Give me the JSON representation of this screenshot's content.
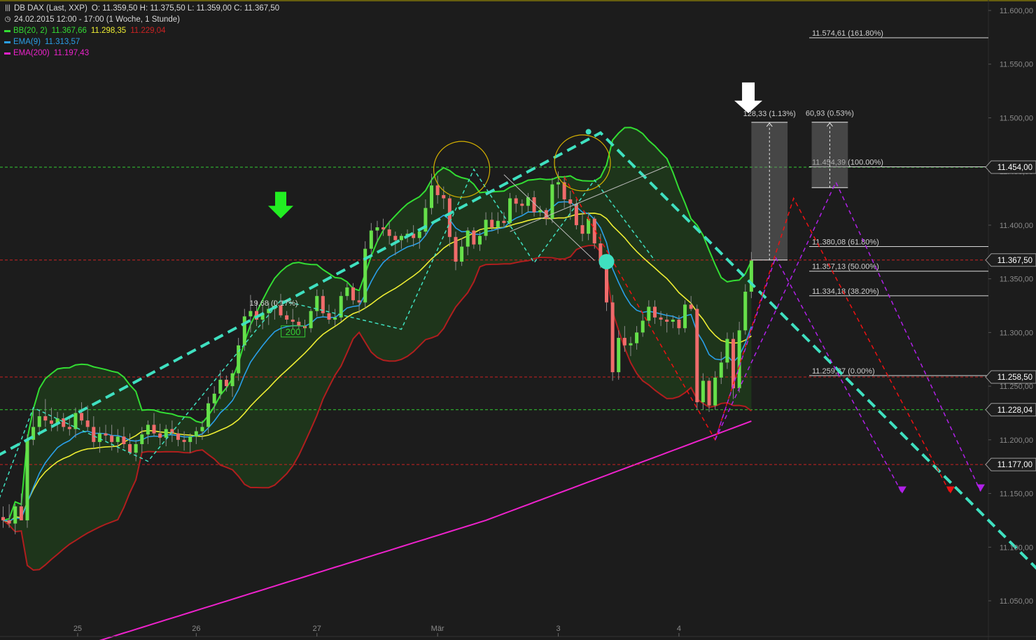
{
  "header": {
    "symbol": "DB DAX (Last, XXP)",
    "ohlc": "O: 11.359,50  H: 11.375,50  L: 11.359,00  C: 11.367,50",
    "timeframe": "24.02.2015 12:00 - 17:00 (1 Woche, 1 Stunde)"
  },
  "indicators": [
    {
      "name": "BB(20, 2)",
      "color": "#33dd33",
      "values": [
        {
          "text": "11.367,66",
          "color": "#33dd33"
        },
        {
          "text": "11.298,35",
          "color": "#eeee33"
        },
        {
          "text": "11.229,04",
          "color": "#cc2222"
        }
      ]
    },
    {
      "name": "EMA(9)",
      "color": "#2a9fe8",
      "values": [
        {
          "text": "11.313,57",
          "color": "#2a9fe8"
        }
      ]
    },
    {
      "name": "EMA(200)",
      "color": "#ee22cc",
      "values": [
        {
          "text": "11.197,43",
          "color": "#ee22cc"
        }
      ]
    }
  ],
  "colors": {
    "background": "#1c1c1c",
    "bull": "#66e04a",
    "bear": "#f06b6b",
    "bb_upper": "#33dd33",
    "bb_mid": "#eeee33",
    "bb_lower": "#b01e1e",
    "ema9": "#2a9fe8",
    "ema200": "#ee22cc",
    "trend": "#3fe0c0",
    "level_red": "#cc2222",
    "level_green": "#33cc33"
  },
  "chart_data": {
    "type": "candlestick",
    "y_axis": {
      "min": 11020,
      "max": 11610,
      "ticks": [
        {
          "v": 11600,
          "t": "11.600,00"
        },
        {
          "v": 11550,
          "t": "11.550,00"
        },
        {
          "v": 11500,
          "t": "11.500,00"
        },
        {
          "v": 11450,
          "t": "11.450,00"
        },
        {
          "v": 11400,
          "t": "11.400,00"
        },
        {
          "v": 11350,
          "t": "11.350,00"
        },
        {
          "v": 11300,
          "t": "11.300,00"
        },
        {
          "v": 11250,
          "t": "11.250,00"
        },
        {
          "v": 11200,
          "t": "11.200,00"
        },
        {
          "v": 11150,
          "t": "11.150,00"
        },
        {
          "v": 11100,
          "t": "11.100,00"
        },
        {
          "v": 11050,
          "t": "11.050,00"
        }
      ]
    },
    "x_labels": [
      {
        "i": 12,
        "t": "25"
      },
      {
        "i": 32,
        "t": "26"
      },
      {
        "i": 52,
        "t": "27"
      },
      {
        "i": 72,
        "t": "Mär"
      },
      {
        "i": 92,
        "t": "3"
      },
      {
        "i": 112,
        "t": "4"
      }
    ],
    "candles": [
      [
        11128,
        11138,
        11118,
        11125
      ],
      [
        11125,
        11140,
        11118,
        11122
      ],
      [
        11122,
        11140,
        11112,
        11138
      ],
      [
        11138,
        11150,
        11125,
        11125
      ],
      [
        11125,
        11205,
        11118,
        11200
      ],
      [
        11200,
        11230,
        11195,
        11212
      ],
      [
        11212,
        11228,
        11204,
        11222
      ],
      [
        11222,
        11238,
        11212,
        11218
      ],
      [
        11218,
        11230,
        11208,
        11215
      ],
      [
        11215,
        11226,
        11208,
        11220
      ],
      [
        11220,
        11225,
        11208,
        11212
      ],
      [
        11212,
        11222,
        11204,
        11210
      ],
      [
        11210,
        11230,
        11202,
        11225
      ],
      [
        11225,
        11235,
        11214,
        11218
      ],
      [
        11218,
        11232,
        11208,
        11212
      ],
      [
        11212,
        11222,
        11192,
        11198
      ],
      [
        11198,
        11212,
        11188,
        11206
      ],
      [
        11206,
        11214,
        11198,
        11204
      ],
      [
        11204,
        11214,
        11190,
        11198
      ],
      [
        11198,
        11210,
        11188,
        11203
      ],
      [
        11203,
        11212,
        11192,
        11196
      ],
      [
        11196,
        11206,
        11186,
        11188
      ],
      [
        11188,
        11200,
        11180,
        11196
      ],
      [
        11196,
        11212,
        11188,
        11205
      ],
      [
        11205,
        11218,
        11196,
        11214
      ],
      [
        11214,
        11225,
        11203,
        11206
      ],
      [
        11206,
        11215,
        11195,
        11202
      ],
      [
        11202,
        11214,
        11194,
        11210
      ],
      [
        11210,
        11218,
        11198,
        11206
      ],
      [
        11206,
        11210,
        11194,
        11200
      ],
      [
        11200,
        11208,
        11190,
        11198
      ],
      [
        11198,
        11206,
        11188,
        11203
      ],
      [
        11203,
        11212,
        11196,
        11208
      ],
      [
        11208,
        11218,
        11200,
        11212
      ],
      [
        11212,
        11240,
        11206,
        11234
      ],
      [
        11234,
        11250,
        11225,
        11243
      ],
      [
        11243,
        11265,
        11238,
        11256
      ],
      [
        11256,
        11260,
        11245,
        11250
      ],
      [
        11250,
        11265,
        11240,
        11262
      ],
      [
        11262,
        11295,
        11255,
        11288
      ],
      [
        11288,
        11322,
        11283,
        11315
      ],
      [
        11315,
        11335,
        11300,
        11320
      ],
      [
        11320,
        11330,
        11306,
        11312
      ],
      [
        11312,
        11326,
        11303,
        11318
      ],
      [
        11318,
        11328,
        11307,
        11322
      ],
      [
        11322,
        11330,
        11312,
        11325
      ],
      [
        11325,
        11336,
        11314,
        11316
      ],
      [
        11316,
        11320,
        11308,
        11312
      ],
      [
        11312,
        11322,
        11303,
        11310
      ],
      [
        11310,
        11314,
        11303,
        11306
      ],
      [
        11306,
        11312,
        11300,
        11304
      ],
      [
        11304,
        11322,
        11300,
        11320
      ],
      [
        11320,
        11340,
        11315,
        11334
      ],
      [
        11334,
        11340,
        11315,
        11318
      ],
      [
        11318,
        11326,
        11308,
        11312
      ],
      [
        11312,
        11322,
        11306,
        11314
      ],
      [
        11314,
        11338,
        11310,
        11334
      ],
      [
        11334,
        11346,
        11330,
        11342
      ],
      [
        11342,
        11346,
        11326,
        11330
      ],
      [
        11330,
        11338,
        11318,
        11328
      ],
      [
        11328,
        11385,
        11322,
        11378
      ],
      [
        11378,
        11402,
        11372,
        11395
      ],
      [
        11395,
        11404,
        11384,
        11398
      ],
      [
        11398,
        11406,
        11390,
        11396
      ],
      [
        11396,
        11404,
        11382,
        11390
      ],
      [
        11390,
        11394,
        11372,
        11386
      ],
      [
        11386,
        11392,
        11378,
        11390
      ],
      [
        11390,
        11396,
        11384,
        11392
      ],
      [
        11392,
        11400,
        11380,
        11388
      ],
      [
        11388,
        11396,
        11378,
        11394
      ],
      [
        11394,
        11424,
        11390,
        11416
      ],
      [
        11416,
        11448,
        11410,
        11437
      ],
      [
        11437,
        11446,
        11420,
        11428
      ],
      [
        11428,
        11436,
        11415,
        11425
      ],
      [
        11425,
        11428,
        11380,
        11389
      ],
      [
        11389,
        11394,
        11358,
        11366
      ],
      [
        11366,
        11388,
        11362,
        11380
      ],
      [
        11380,
        11398,
        11372,
        11395
      ],
      [
        11395,
        11398,
        11378,
        11382
      ],
      [
        11382,
        11394,
        11376,
        11390
      ],
      [
        11390,
        11412,
        11386,
        11405
      ],
      [
        11405,
        11412,
        11395,
        11398
      ],
      [
        11398,
        11412,
        11392,
        11404
      ],
      [
        11404,
        11412,
        11398,
        11402
      ],
      [
        11402,
        11430,
        11398,
        11425
      ],
      [
        11425,
        11428,
        11412,
        11420
      ],
      [
        11420,
        11424,
        11410,
        11418
      ],
      [
        11418,
        11430,
        11412,
        11426
      ],
      [
        11426,
        11432,
        11408,
        11412
      ],
      [
        11412,
        11418,
        11408,
        11414
      ],
      [
        11414,
        11416,
        11400,
        11406
      ],
      [
        11406,
        11444,
        11402,
        11438
      ],
      [
        11438,
        11450,
        11425,
        11440
      ],
      [
        11440,
        11446,
        11416,
        11424
      ],
      [
        11424,
        11432,
        11405,
        11420
      ],
      [
        11420,
        11424,
        11396,
        11400
      ],
      [
        11400,
        11412,
        11385,
        11392
      ],
      [
        11392,
        11412,
        11386,
        11406
      ],
      [
        11406,
        11408,
        11378,
        11383
      ],
      [
        11383,
        11392,
        11360,
        11366
      ],
      [
        11366,
        11372,
        11320,
        11328
      ],
      [
        11328,
        11335,
        11255,
        11263
      ],
      [
        11263,
        11302,
        11256,
        11295
      ],
      [
        11295,
        11306,
        11282,
        11288
      ],
      [
        11288,
        11296,
        11278,
        11290
      ],
      [
        11290,
        11306,
        11284,
        11300
      ],
      [
        11300,
        11318,
        11296,
        11311
      ],
      [
        11311,
        11330,
        11306,
        11324
      ],
      [
        11324,
        11330,
        11308,
        11314
      ],
      [
        11314,
        11320,
        11306,
        11312
      ],
      [
        11312,
        11318,
        11300,
        11310
      ],
      [
        11310,
        11316,
        11304,
        11312
      ],
      [
        11312,
        11316,
        11298,
        11304
      ],
      [
        11304,
        11330,
        11300,
        11326
      ],
      [
        11326,
        11334,
        11320,
        11322
      ],
      [
        11322,
        11326,
        11228,
        11235
      ],
      [
        11235,
        11262,
        11228,
        11255
      ],
      [
        11255,
        11258,
        11226,
        11232
      ],
      [
        11232,
        11264,
        11228,
        11258
      ],
      [
        11258,
        11282,
        11252,
        11272
      ],
      [
        11272,
        11300,
        11266,
        11294
      ],
      [
        11294,
        11300,
        11238,
        11248
      ],
      [
        11248,
        11310,
        11244,
        11302
      ],
      [
        11302,
        11345,
        11298,
        11338
      ],
      [
        11338,
        11375,
        11332,
        11367
      ]
    ],
    "levels": [
      {
        "v": 11454.0,
        "t": "11.454,00",
        "color": "#33cc33"
      },
      {
        "v": 11367.5,
        "t": "11.367,50",
        "color": "#cc2222"
      },
      {
        "v": 11258.5,
        "t": "11.258,50",
        "color": "#cc2222"
      },
      {
        "v": 11228.04,
        "t": "11.228,04",
        "color": "#33cc33"
      },
      {
        "v": 11177.0,
        "t": "11.177,00",
        "color": "#cc2222"
      }
    ],
    "fibonacci": [
      {
        "v": 11574.61,
        "t": "11.574,61 (161.80%)"
      },
      {
        "v": 11454.39,
        "t": "11.454,39 (100.00%)"
      },
      {
        "v": 11380.08,
        "t": "11.380,08 (61.80%)"
      },
      {
        "v": 11357.13,
        "t": "11.357,13 (50.00%)"
      },
      {
        "v": 11334.18,
        "t": "11.334,18 (38.20%)"
      },
      {
        "v": 11259.87,
        "t": "11.259,87 (0.00%)"
      }
    ],
    "measures": [
      {
        "i0": 124,
        "i1": 130,
        "from": 11367.5,
        "to": 11495.8,
        "label": "128,33 (1.13%)"
      },
      {
        "i0": 134,
        "i1": 140,
        "from": 11435.0,
        "to": 11495.9,
        "label": "60,93 (0.53%)"
      }
    ],
    "annotations": [
      {
        "i": 46,
        "v": 11323,
        "t": "19,68 (0.17%)"
      },
      {
        "i": 47,
        "v": 11301,
        "t": "200"
      }
    ],
    "trendline": [
      [
        -1,
        11185
      ],
      [
        99,
        11486
      ],
      [
        182,
        11020
      ]
    ],
    "zigzag": [
      [
        -1,
        11140
      ],
      [
        5,
        11230
      ],
      [
        24,
        11180
      ],
      [
        46,
        11330
      ],
      [
        66,
        11303
      ],
      [
        78,
        11452
      ],
      [
        88,
        11365
      ],
      [
        98,
        11442
      ],
      [
        108,
        11367
      ]
    ],
    "red_projection": [
      [
        93,
        11445
      ],
      [
        118,
        11200
      ],
      [
        131,
        11425
      ],
      [
        157,
        11150
      ]
    ],
    "purple_projection": [
      [
        118,
        11200
      ],
      [
        138,
        11440
      ],
      [
        162,
        11152
      ]
    ],
    "purple_projection2": [
      [
        118,
        11200
      ],
      [
        128,
        11370
      ],
      [
        149,
        11150
      ]
    ]
  }
}
